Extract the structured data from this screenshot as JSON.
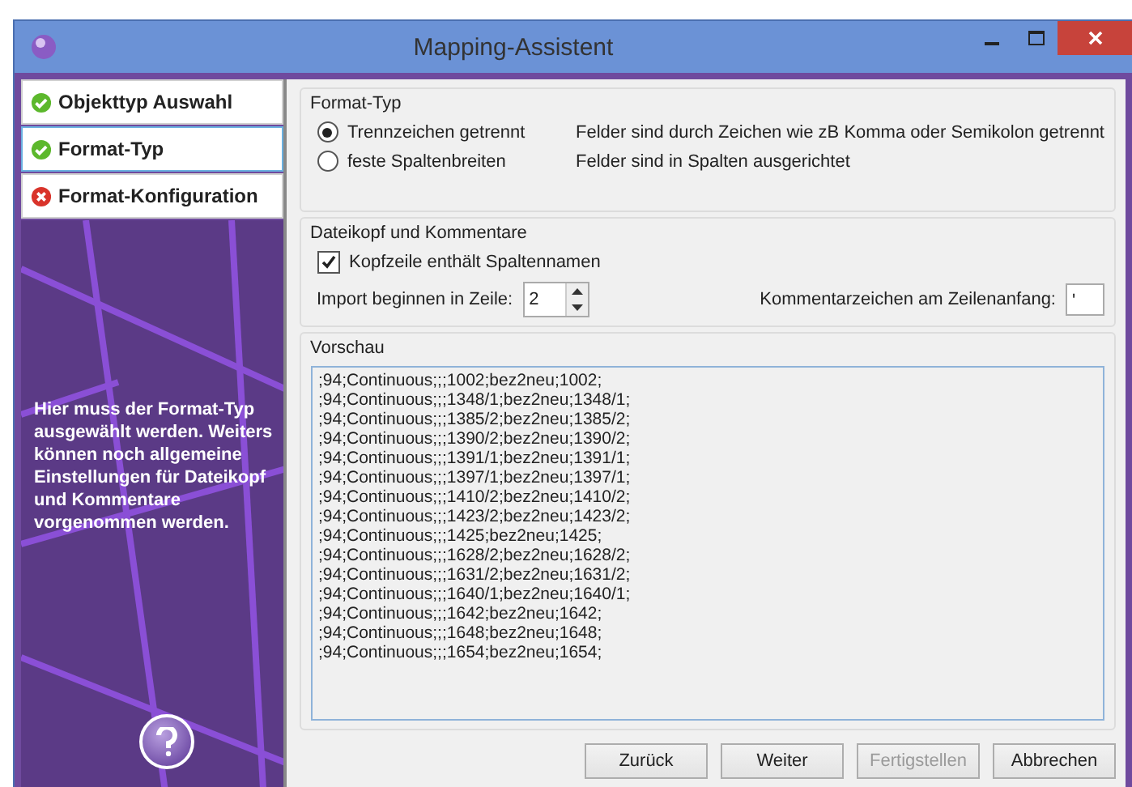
{
  "window": {
    "title": "Mapping-Assistent"
  },
  "steps": [
    {
      "label": "Objekttyp Auswahl",
      "kind": "done",
      "selected": false
    },
    {
      "label": "Format-Typ",
      "kind": "done",
      "selected": true
    },
    {
      "label": "Format-Konfiguration",
      "kind": "error",
      "selected": false
    }
  ],
  "help_text": "Hier muss der Format-Typ ausgewählt werden. Weiters können noch allgemeine Einstellungen für Dateikopf und Kommentare vorgenommen werden.",
  "format_group": {
    "title": "Format-Typ",
    "options": [
      {
        "label": "Trennzeichen getrennt",
        "description": "Felder sind durch Zeichen wie zB Komma oder Semikolon getrennt",
        "selected": true
      },
      {
        "label": "feste Spaltenbreiten",
        "description": "Felder sind in Spalten ausgerichtet",
        "selected": false
      }
    ]
  },
  "header_group": {
    "title": "Dateikopf und Kommentare",
    "header_checkbox": {
      "label": "Kopfzeile enthält Spaltennamen",
      "checked": true
    },
    "start_row": {
      "label": "Import beginnen in Zeile:",
      "value": "2"
    },
    "comment_char": {
      "label": "Kommentarzeichen am Zeilenanfang:",
      "value": "'"
    }
  },
  "preview": {
    "title": "Vorschau",
    "lines": [
      ";94;Continuous;;;1002;bez2neu;1002;",
      ";94;Continuous;;;1348/1;bez2neu;1348/1;",
      ";94;Continuous;;;1385/2;bez2neu;1385/2;",
      ";94;Continuous;;;1390/2;bez2neu;1390/2;",
      ";94;Continuous;;;1391/1;bez2neu;1391/1;",
      ";94;Continuous;;;1397/1;bez2neu;1397/1;",
      ";94;Continuous;;;1410/2;bez2neu;1410/2;",
      ";94;Continuous;;;1423/2;bez2neu;1423/2;",
      ";94;Continuous;;;1425;bez2neu;1425;",
      ";94;Continuous;;;1628/2;bez2neu;1628/2;",
      ";94;Continuous;;;1631/2;bez2neu;1631/2;",
      ";94;Continuous;;;1640/1;bez2neu;1640/1;",
      ";94;Continuous;;;1642;bez2neu;1642;",
      ";94;Continuous;;;1648;bez2neu;1648;",
      ";94;Continuous;;;1654;bez2neu;1654;"
    ]
  },
  "buttons": [
    {
      "label": "Zurück",
      "disabled": false
    },
    {
      "label": "Weiter",
      "disabled": false
    },
    {
      "label": "Fertigstellen",
      "disabled": true
    },
    {
      "label": "Abbrechen",
      "disabled": false
    }
  ]
}
